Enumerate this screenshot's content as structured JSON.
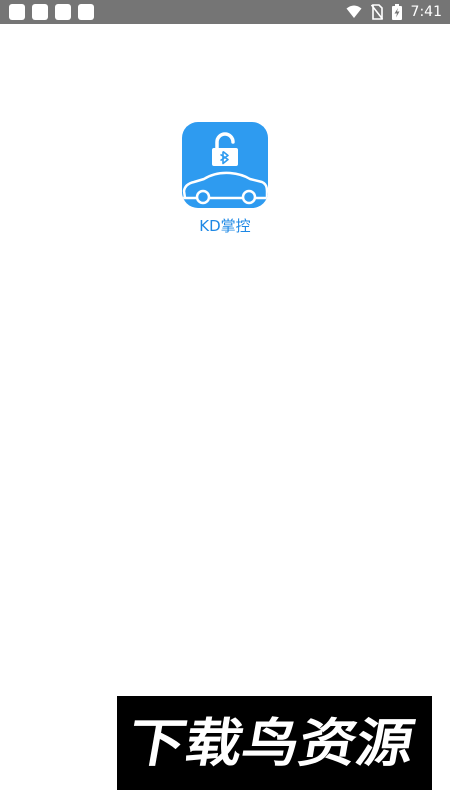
{
  "status_bar": {
    "time": "7:41",
    "notification_icons": [
      "notification-icon",
      "notification-icon",
      "notification-icon",
      "notification-icon"
    ],
    "icons": [
      "wifi-icon",
      "no-sim-icon",
      "battery-charging-icon"
    ]
  },
  "launcher": {
    "app": {
      "label": "KD掌控",
      "icon": "car-bluetooth-lock-icon",
      "color": "#2e9bf0"
    }
  },
  "watermark": {
    "text": "下载鸟资源"
  },
  "colors": {
    "status_bar": "#757575",
    "background": "#ffffff",
    "label": "#1e88e5",
    "watermark_bg": "#000000"
  }
}
